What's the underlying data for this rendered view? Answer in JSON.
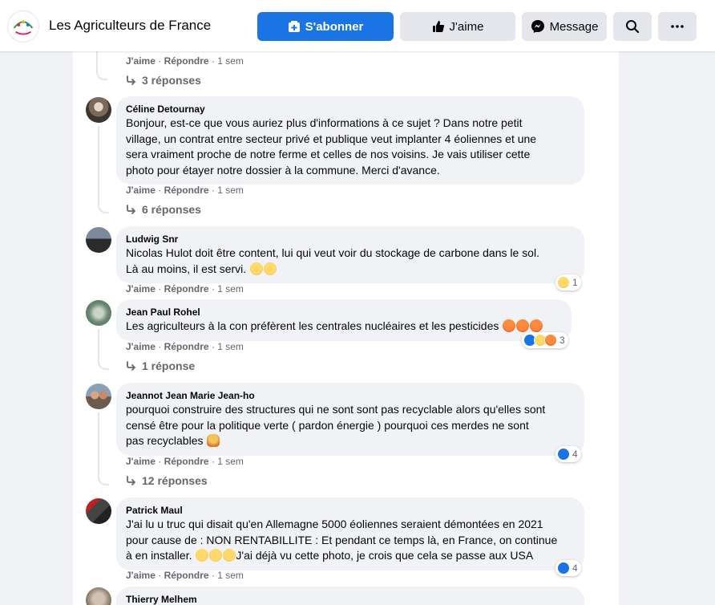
{
  "header": {
    "page_name": "Les Agriculteurs de France",
    "logo_text": "Les Agriculteurs de France",
    "subscribe_label": "S'abonner",
    "like_label": "J'aime",
    "message_label": "Message"
  },
  "labels": {
    "like": "J'aime",
    "reply": "Répondre",
    "time": "1 sem"
  },
  "top_thread": {
    "replies": "3 réponses"
  },
  "comments": [
    {
      "author": "Céline Detournay",
      "text": "Bonjour, est-ce que vous auriez plus d'informations à ce sujet ? Dans notre petit\nvillage, un contrat entre secteur privé et publique veut implanter 4 éoliennes et une\nsera vraiment proche de notre ferme et celles de nos voisins. Je vais utiliser cette\nphoto pour étayer notre dossier à la commune. Merci d'avance.",
      "replies": "6 réponses"
    },
    {
      "author": "Ludwig Snr",
      "text": "Nicolas Hulot doit être content, lui qui veut voir du stockage de carbone dans le sol.\nLà au moins, il est servi.",
      "reaction_count": "1"
    },
    {
      "author": "Jean Paul Rohel",
      "text": "Les agriculteurs à la con préfèrent les centrales nucléaires et les pesticides",
      "reaction_count": "3",
      "replies": "1 réponse"
    },
    {
      "author": "Jeannot Jean Marie Jean-ho",
      "text": "pourquoi construire des structures qui ne sont sont pas recyclable alors qu'elles sont\ncensé être pour la politique verte ( pardon énergie ) pourquoi ces merdes ne sont\npas recyclables",
      "reaction_count": "4",
      "replies": "12 réponses"
    },
    {
      "author": "Patrick Maul",
      "text_line1": "J'ai lu u truc qui disait qu'en Allemagne 5000 éoliennes seraient démontées en 2021\npour cause de : NON RENTABILLITE : Et pendant ce temps là, en France, on continue\nà en installer.",
      "text_line2": "J'ai déjà vu cette photo, je crois que cela se passe aux USA",
      "reaction_count": "4"
    },
    {
      "author": "Thierry Melhem"
    }
  ],
  "colors": {
    "primary": "#1b74e4",
    "secondary_text": "#65676b",
    "bubble": "#f0f2f5"
  }
}
